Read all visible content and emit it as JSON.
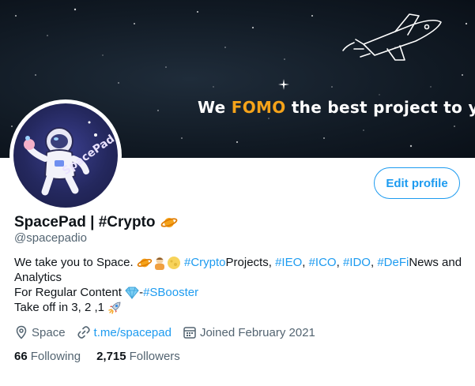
{
  "banner": {
    "tagline_pre": "We ",
    "tagline_accent": "FOMO",
    "tagline_post": " the best project to you."
  },
  "avatar": {
    "logo_text": "SpacePad"
  },
  "actions": {
    "edit_profile": "Edit profile"
  },
  "profile": {
    "display_name": "SpacePad | #Crypto",
    "handle": "@spacepadio",
    "bio": {
      "line1_text": "We take you to Space.",
      "line1_hashtag": "#Crypto",
      "line1_mid": " Projects, ",
      "tag_ieo": "#IEO",
      "sep1": ", ",
      "tag_ico": "#ICO",
      "sep2": ", ",
      "tag_ido": "#IDO",
      "sep3": ", ",
      "tag_defi": "#DeFi",
      "line1_end": " News and",
      "line2": "Analytics",
      "line3_text": "For Regular Content",
      "line3_dash": "- ",
      "line3_tag": "#SBooster",
      "line4_text": "Take off in 3, 2 ,1"
    },
    "location": "Space",
    "website": "t.me/spacepad",
    "joined": "Joined February 2021",
    "following_count": "66",
    "following_label": "Following",
    "followers_count": "2,715",
    "followers_label": "Followers"
  },
  "colors": {
    "accent": "#1d9bf0",
    "muted": "#536471",
    "banner_accent": "#f5a31a"
  },
  "icons": [
    "ringed-planet-icon",
    "astronaut-icon",
    "moon-icon",
    "diamond-icon",
    "rocket-icon",
    "location-pin-icon",
    "link-icon",
    "calendar-icon"
  ]
}
